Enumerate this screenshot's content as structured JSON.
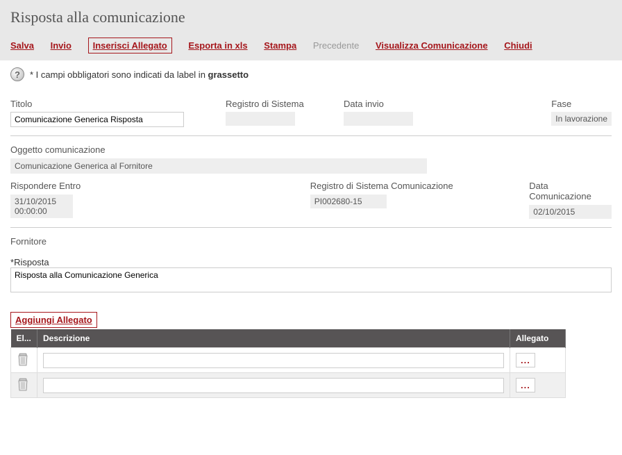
{
  "page": {
    "title": "Risposta alla comunicazione"
  },
  "toolbar": {
    "salva": "Salva",
    "invio": "Invio",
    "inserisci_allegato": "Inserisci Allegato",
    "esporta_xls": "Esporta in xls",
    "stampa": "Stampa",
    "precedente": "Precedente",
    "visualizza_comunicazione": "Visualizza Comunicazione",
    "chiudi": "Chiudi"
  },
  "info": {
    "text_prefix": "* I campi obbligatori sono indicati da label in ",
    "text_bold": "grassetto",
    "help_glyph": "?"
  },
  "form": {
    "titolo_label": "Titolo",
    "titolo_value": "Comunicazione Generica Risposta",
    "registro_label": "Registro di Sistema",
    "registro_value": "",
    "data_invio_label": "Data invio",
    "data_invio_value": "",
    "fase_label": "Fase",
    "fase_value": "In lavorazione",
    "oggetto_label": "Oggetto comunicazione",
    "oggetto_value": "Comunicazione Generica al Fornitore",
    "rispondere_entro_label": "Rispondere Entro",
    "rispondere_entro_value": "31/10/2015 00:00:00",
    "registro_com_label": "Registro di Sistema Comunicazione",
    "registro_com_value": "PI002680-15",
    "data_com_label": "Data Comunicazione",
    "data_com_value": "02/10/2015",
    "fornitore_label": "Fornitore",
    "risposta_label": "Risposta",
    "risposta_asterisk": "*",
    "risposta_value": "Risposta alla Comunicazione Generica"
  },
  "attachments": {
    "add_button": "Aggiungi Allegato",
    "columns": {
      "elimina": "El...",
      "descrizione": "Descrizione",
      "allegato": "Allegato"
    },
    "browse_label": "...",
    "rows": [
      {
        "desc": ""
      },
      {
        "desc": ""
      }
    ]
  }
}
